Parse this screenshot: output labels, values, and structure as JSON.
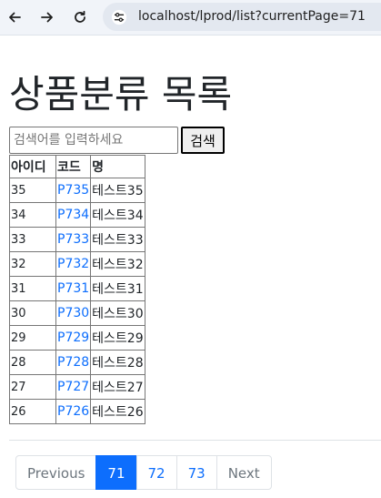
{
  "browser": {
    "url": "localhost/lprod/list?currentPage=71"
  },
  "page": {
    "title": "상품분류 목록"
  },
  "search": {
    "placeholder": "검색어를 입력하세요",
    "button_label": "검색"
  },
  "table": {
    "headers": [
      "아이디",
      "코드",
      "명"
    ],
    "rows": [
      {
        "id": "35",
        "code": "P735",
        "name": "테스트35"
      },
      {
        "id": "34",
        "code": "P734",
        "name": "테스트34"
      },
      {
        "id": "33",
        "code": "P733",
        "name": "테스트33"
      },
      {
        "id": "32",
        "code": "P732",
        "name": "테스트32"
      },
      {
        "id": "31",
        "code": "P731",
        "name": "테스트31"
      },
      {
        "id": "30",
        "code": "P730",
        "name": "테스트30"
      },
      {
        "id": "29",
        "code": "P729",
        "name": "테스트29"
      },
      {
        "id": "28",
        "code": "P728",
        "name": "테스트28"
      },
      {
        "id": "27",
        "code": "P727",
        "name": "테스트27"
      },
      {
        "id": "26",
        "code": "P726",
        "name": "테스트26"
      }
    ]
  },
  "pagination": {
    "previous": "Previous",
    "pages": [
      "71",
      "72",
      "73"
    ],
    "active_page": "71",
    "next": "Next"
  },
  "colors": {
    "accent": "#0d6efd",
    "disabled": "#6c757d"
  }
}
